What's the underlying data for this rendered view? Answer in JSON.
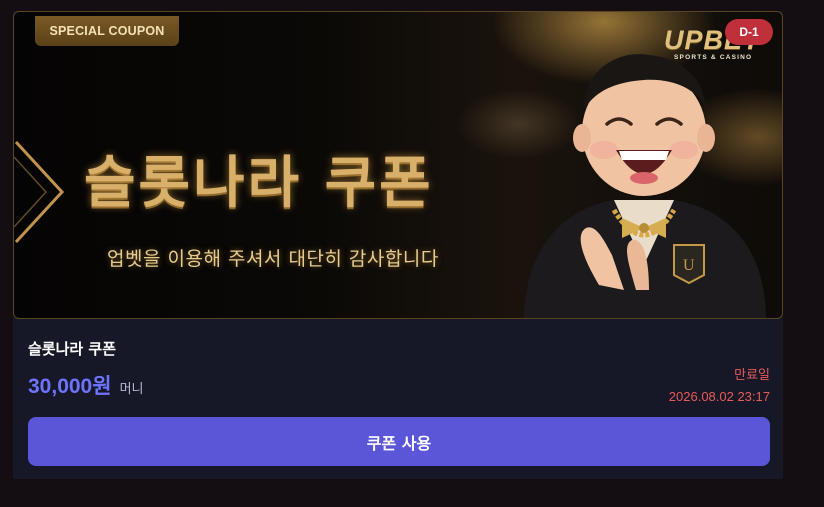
{
  "banner": {
    "tag": "SPECIAL COUPON",
    "title": "슬롯나라 쿠폰",
    "subtitle": "업벳을 이용해 주셔서 대단히 감사합니다",
    "logo_main": "UPBET",
    "logo_sub": "SPORTS & CASINO",
    "dday": "D-1"
  },
  "coupon": {
    "name": "슬롯나라 쿠폰",
    "amount": "30,000",
    "amount_unit": "원",
    "money_label": "머니",
    "expire_label": "만료일",
    "expire_date": "2026.08.02 23:17",
    "use_button": "쿠폰 사용"
  },
  "colors": {
    "accent": "#5b56d8",
    "amount": "#6d73ff",
    "expire": "#e85a5a",
    "gold": "#d9b06a"
  }
}
